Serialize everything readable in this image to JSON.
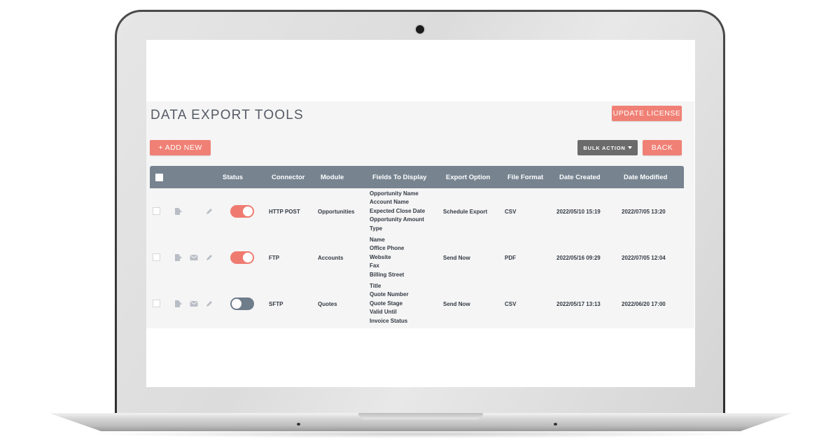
{
  "page": {
    "title": "DATA EXPORT TOOLS",
    "update_license_label": "UPDATE LICENSE",
    "add_new_label": "+ ADD NEW",
    "bulk_action_label": "BULK ACTION",
    "back_label": "BACK"
  },
  "colors": {
    "accent": "#f08075",
    "header_bg": "#778490",
    "toggle_on": "#ef7b70",
    "toggle_off": "#6f7d8b",
    "bulk_bg": "#6b6b6b"
  },
  "table": {
    "columns": [
      "Status",
      "Connector",
      "Module",
      "Fields To Display",
      "Export Option",
      "File Format",
      "Date Created",
      "Date Modified"
    ],
    "rows": [
      {
        "icons": [
          "export-icon",
          "edit-icon"
        ],
        "status_on": true,
        "connector": "HTTP POST",
        "module": "Opportunities",
        "fields": [
          "Opportunity Name",
          "Account Name",
          "Expected Close Date",
          "Opportunity Amount",
          "Type"
        ],
        "export_option": "Schedule Export",
        "file_format": "CSV",
        "date_created": "2022/05/10 15:19",
        "date_modified": "2022/07/05 13:20"
      },
      {
        "icons": [
          "export-icon",
          "email-icon",
          "edit-icon"
        ],
        "status_on": true,
        "connector": "FTP",
        "module": "Accounts",
        "fields": [
          "Name",
          "Office Phone",
          "Website",
          "Fax",
          "Billing Street"
        ],
        "export_option": "Send Now",
        "file_format": "PDF",
        "date_created": "2022/05/16 09:29",
        "date_modified": "2022/07/05 12:04"
      },
      {
        "icons": [
          "export-icon",
          "email-icon",
          "edit-icon"
        ],
        "status_on": false,
        "connector": "SFTP",
        "module": "Quotes",
        "fields": [
          "Title",
          "Quote Number",
          "Quote Stage",
          "Valid Until",
          "Invoice Status"
        ],
        "export_option": "Send Now",
        "file_format": "CSV",
        "date_created": "2022/05/17 13:13",
        "date_modified": "2022/06/20 17:00"
      }
    ]
  }
}
